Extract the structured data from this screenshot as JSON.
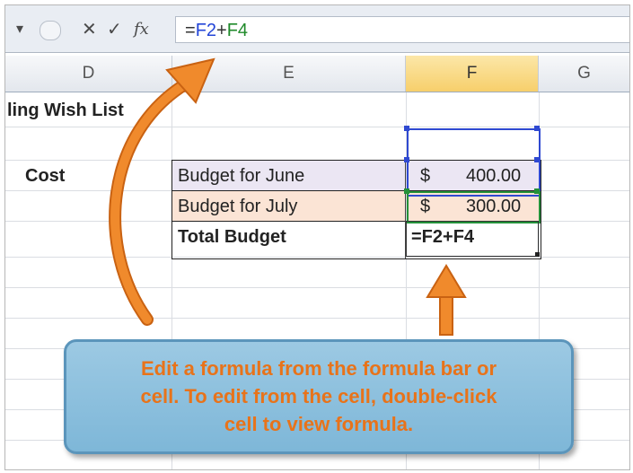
{
  "formula_bar": {
    "dropdown_glyph": "▾",
    "cancel_glyph": "✕",
    "enter_glyph": "✓",
    "fx_label": "fx",
    "formula_eq": "=",
    "formula_ref1": "F2",
    "formula_plus": "+",
    "formula_ref2": "F4"
  },
  "columns": {
    "d": "D",
    "e": "E",
    "f": "F",
    "g": "G"
  },
  "cells": {
    "d_title": "ling Wish List",
    "d_cost": "Cost",
    "e_june": "Budget for June",
    "e_july": "Budget for July",
    "e_total": "Total Budget",
    "f_june_currency": "$",
    "f_june_value": "400.00",
    "f_july_currency": "$",
    "f_july_value": "300.00",
    "f_total_formula": "=F2+F4"
  },
  "callout": {
    "line1": "Edit a formula from the formula bar or",
    "line2": "cell. To edit from the cell, double-click",
    "line3": "cell to view formula."
  },
  "colors": {
    "june_fill": "#ebe6f3",
    "july_fill": "#fbe4d5",
    "arrow": "#e8771e",
    "selection_blue": "#2f49d1",
    "selection_green": "#24913a"
  }
}
